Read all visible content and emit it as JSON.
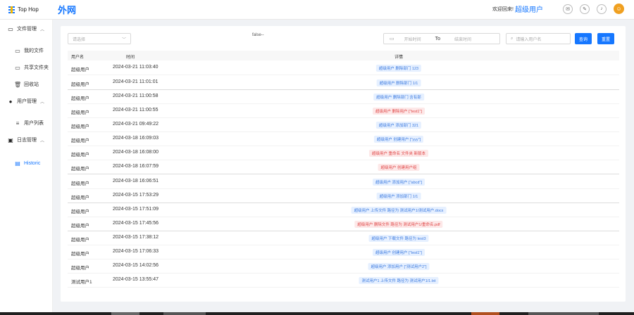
{
  "header": {
    "brand": "Top Hop",
    "site_title": "外网",
    "welcome": "欢迎回来!",
    "user_name": "超级用户",
    "icons": [
      "mail-icon",
      "edit-icon",
      "bell-icon",
      "user-avatar-icon"
    ]
  },
  "sidebar": {
    "items": [
      {
        "label": "文件管理",
        "icon": "folder-icon",
        "group": true
      },
      {
        "label": "我的文件",
        "icon": "folder-icon"
      },
      {
        "label": "共享文件夹",
        "icon": "folder-icon"
      },
      {
        "label": "回收站",
        "icon": "trash-icon"
      },
      {
        "label": "用户管理",
        "icon": "user-icon",
        "group": true
      },
      {
        "label": "用户列表",
        "icon": "list-icon"
      },
      {
        "label": "日志管理",
        "icon": "log-icon",
        "group": true
      },
      {
        "label": "Historic",
        "icon": "doc-icon",
        "active": true
      }
    ]
  },
  "filters": {
    "select_placeholder": "请选择",
    "debug_text": "false--",
    "date_start_placeholder": "开始时间",
    "date_to": "To",
    "date_end_placeholder": "结束时间",
    "search_placeholder": "请输入用户名",
    "query_label": "查询",
    "reset_label": "重置"
  },
  "table": {
    "headers": [
      "用户名",
      "时间",
      "详情"
    ],
    "rows": [
      {
        "user": "超级用户",
        "time": "2024-03-21 11:03:40",
        "detail": "超级用户 删除部门 123",
        "color": "blue"
      },
      {
        "user": "超级用户",
        "time": "2024-03-21 11:01:01",
        "detail": "超级用户 删除部门 1/1",
        "color": "blue"
      },
      {
        "user": "超级用户",
        "time": "2024-03-21 11:00:58",
        "detail": "超级用户 删除部门 含有部",
        "color": "blue"
      },
      {
        "user": "超级用户",
        "time": "2024-03-21 11:00:55",
        "detail": "超级用户 删除用户 [\"test1\"]",
        "color": "red"
      },
      {
        "user": "超级用户",
        "time": "2024-03-21 09:49:22",
        "detail": "超级用户 添加部门 321",
        "color": "blue"
      },
      {
        "user": "超级用户",
        "time": "2024-03-18 16:09:03",
        "detail": "超级用户 创建用户 [\"yyy\"]",
        "color": "blue"
      },
      {
        "user": "超级用户",
        "time": "2024-03-18 16:08:00",
        "detail": "超级用户 重命名 文件夹 新版本",
        "color": "red"
      },
      {
        "user": "超级用户",
        "time": "2024-03-18 16:07:59",
        "detail": "超级用户 创建用户组",
        "color": "red"
      },
      {
        "user": "超级用户",
        "time": "2024-03-18 16:06:51",
        "detail": "超级用户 添加用户 [\"abcd\"]",
        "color": "blue"
      },
      {
        "user": "超级用户",
        "time": "2024-03-15 17:53:29",
        "detail": "超级用户 添加部门 1/1",
        "color": "blue"
      },
      {
        "user": "超级用户",
        "time": "2024-03-15 17:51:09",
        "detail": "超级用户 上传文件 路径为 测试用户1/测试用户.docx",
        "color": "blue"
      },
      {
        "user": "超级用户",
        "time": "2024-03-15 17:45:56",
        "detail": "超级用户 删除文件 路径为 测试用户1/重命名.pdf",
        "color": "red"
      },
      {
        "user": "超级用户",
        "time": "2024-03-15 17:38:12",
        "detail": "超级用户 下载文件 路径为 test3",
        "color": "blue"
      },
      {
        "user": "超级用户",
        "time": "2024-03-15 17:06:33",
        "detail": "超级用户 创建用户 [\"test1\"]",
        "color": "blue"
      },
      {
        "user": "超级用户",
        "time": "2024-03-15 14:02:56",
        "detail": "超级用户 添加用户 [\"测试用户2\"]",
        "color": "blue"
      },
      {
        "user": "测试用户1",
        "time": "2024-03-15 13:55:47",
        "detail": "测试用户1 上传文件 路径为 测试用户1/1.txt",
        "color": "blue"
      }
    ]
  },
  "colors": {
    "accent": "#1677ff",
    "blue_tag_bg": "#e6f0ff",
    "red_tag_bg": "#fde8e8",
    "red_tag_text": "#e04848"
  }
}
